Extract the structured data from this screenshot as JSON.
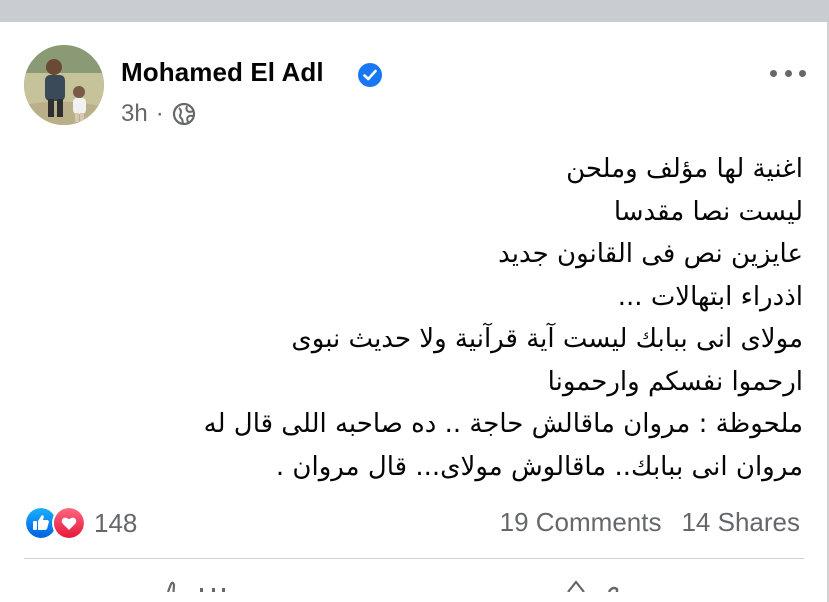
{
  "post": {
    "author": "Mohamed El Adl",
    "verified": true,
    "time": "3h",
    "separator": "·",
    "audience_icon": "globe-icon",
    "more_icon": "more-dots-icon",
    "lines": [
      "اغنية لها مؤلف وملحن",
      "ليست نصا مقدسا",
      "عايزين نص فى القانون جديد",
      "اذدراء ابتهالات ...",
      "مولاى انى ببابك ليست آية قرآنية ولا حديث نبوى",
      "ارحموا نفسكم وارحمونا",
      "ملحوظة : مروان ماقالش حاجة .. ده صاحبه اللى قال له",
      "مروان انى ببابك.. ماقالوش مولاى... قال مروان ."
    ]
  },
  "reactions": {
    "icons": [
      "like-icon",
      "love-icon"
    ],
    "count": "148"
  },
  "stats": {
    "comments": "19 Comments",
    "shares": "14 Shares"
  },
  "colors": {
    "facebook_blue": "#1877f2",
    "love_red": "#f33e58",
    "secondary_text": "#65676b"
  }
}
